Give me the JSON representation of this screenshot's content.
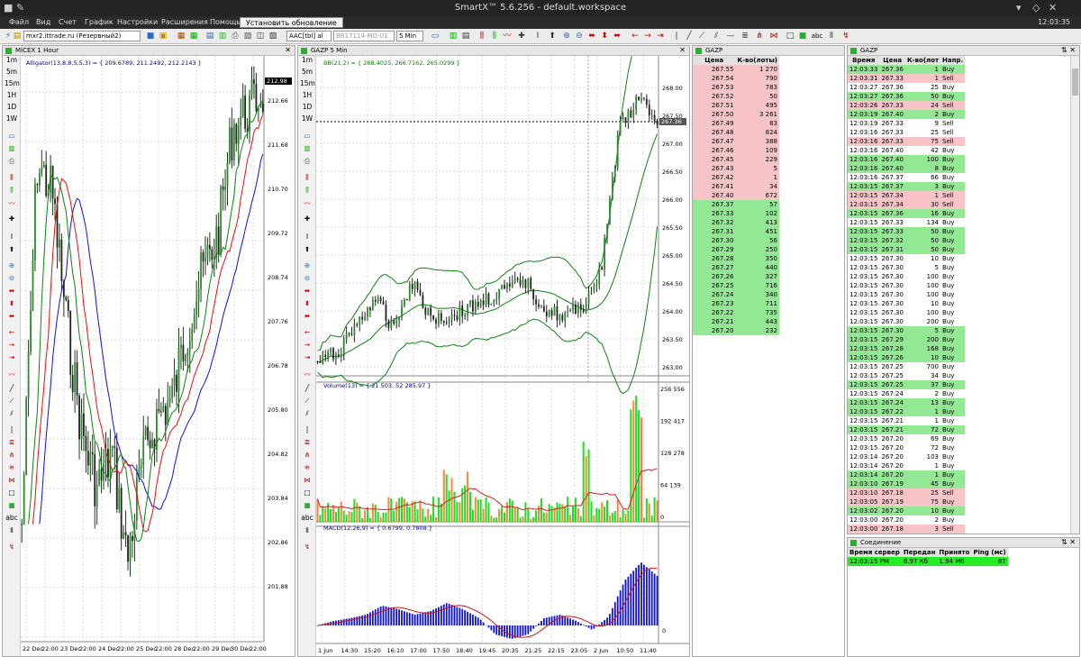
{
  "app": {
    "title": "SmartX™ 5.6.256 - default.workspace",
    "clock": "12:03:35"
  },
  "menu": [
    "Файл",
    "Вид",
    "Счет",
    "График",
    "Настройки",
    "Расширения",
    "Помощь"
  ],
  "update_button": "Установить обновление",
  "toolbar": {
    "account": "mxr2.ittrade.ru (Резервный2)",
    "symbol": "AAC[tbl] al",
    "instrument": "BR17114-MO-01",
    "interval": "5 Min"
  },
  "timeframes": [
    "1m",
    "5m",
    "15m",
    "1H",
    "1D",
    "1W"
  ],
  "chart1": {
    "title": "MICEX 1 Hour",
    "indicator": "Alligator(13,8,8,5,5,3) = { 209.6789, 211.2492, 212.2143 }",
    "price_tag": "212.98",
    "y_ticks": [
      "212.66",
      "211.68",
      "210.70",
      "209.72",
      "208.74",
      "207.76",
      "206.78",
      "205.80",
      "204.82",
      "203.84",
      "202.86",
      "201.88"
    ],
    "x_ticks": [
      "22 Dec",
      "22:00",
      "23 Dec",
      "22:00",
      "24 Dec",
      "22:00",
      "25 Dec",
      "22:00",
      "28 Dec",
      "22:00",
      "29 Dec",
      "30 Dec",
      "22:00"
    ]
  },
  "chart2": {
    "title": "GAZP 5 Min",
    "indicator": "BB(21,2) = { 268.4025, 266.7162, 265.0299 }",
    "price_tag": "267.36",
    "y_ticks": [
      "268.00",
      "267.50",
      "267.00",
      "266.50",
      "266.00",
      "265.50",
      "265.00",
      "264.50",
      "264.00",
      "263.50",
      "263.00"
    ],
    "vol_label": "Volume(13) = { 21 503, 52 285.97 }",
    "vol_ticks": [
      "256 556",
      "192 417",
      "128 278",
      "64 139",
      "0"
    ],
    "macd_label": "MACD(12,26,9) = { 0.6799, 0.7808 }",
    "macd_tick": "0",
    "x_ticks": [
      "1 Jun",
      "14:30",
      "15:20",
      "16:10",
      "17:00",
      "17:50",
      "18:40",
      "19:45",
      "20:35",
      "21:25",
      "22:15",
      "23:05",
      "2 Jun",
      "10:50",
      "11:40"
    ]
  },
  "book": {
    "title": "GAZP",
    "headers": [
      "Цена",
      "К-во(лоты)"
    ],
    "rows": [
      [
        "267.55",
        "1 270",
        "s"
      ],
      [
        "267.54",
        "790",
        "s"
      ],
      [
        "267.53",
        "783",
        "s"
      ],
      [
        "267.52",
        "50",
        "s"
      ],
      [
        "267.51",
        "495",
        "s"
      ],
      [
        "267.50",
        "3 261",
        "s"
      ],
      [
        "267.49",
        "83",
        "s"
      ],
      [
        "267.48",
        "824",
        "s"
      ],
      [
        "267.47",
        "388",
        "s"
      ],
      [
        "267.46",
        "109",
        "s"
      ],
      [
        "267.45",
        "229",
        "s"
      ],
      [
        "267.43",
        "5",
        "s"
      ],
      [
        "267.42",
        "1",
        "s"
      ],
      [
        "267.41",
        "34",
        "s"
      ],
      [
        "267.40",
        "672",
        "s"
      ],
      [
        "267.37",
        "57",
        "b"
      ],
      [
        "267.33",
        "102",
        "b"
      ],
      [
        "267.32",
        "413",
        "b"
      ],
      [
        "267.31",
        "451",
        "b"
      ],
      [
        "267.30",
        "56",
        "b"
      ],
      [
        "267.29",
        "250",
        "b"
      ],
      [
        "267.28",
        "350",
        "b"
      ],
      [
        "267.27",
        "440",
        "b"
      ],
      [
        "267.26",
        "327",
        "b"
      ],
      [
        "267.25",
        "716",
        "b"
      ],
      [
        "267.24",
        "340",
        "b"
      ],
      [
        "267.23",
        "711",
        "b"
      ],
      [
        "267.22",
        "735",
        "b"
      ],
      [
        "267.21",
        "443",
        "b"
      ],
      [
        "267.20",
        "232",
        "b"
      ]
    ]
  },
  "trades": {
    "title": "GAZP",
    "headers": [
      "Время",
      "Цена",
      "К-во(лот",
      "Напр."
    ],
    "rows": [
      [
        "12:03:33",
        "267.36",
        "1",
        "Buy"
      ],
      [
        "12:03:31",
        "267.33",
        "1",
        "Sell"
      ],
      [
        "12:03:27",
        "267.36",
        "25",
        "Buy"
      ],
      [
        "12:03:27",
        "267.36",
        "50",
        "Buy"
      ],
      [
        "12:03:26",
        "267.33",
        "24",
        "Sell"
      ],
      [
        "12:03:19",
        "267.40",
        "2",
        "Buy"
      ],
      [
        "12:03:19",
        "267.33",
        "9",
        "Sell"
      ],
      [
        "12:03:16",
        "267.33",
        "25",
        "Sell"
      ],
      [
        "12:03:16",
        "267.33",
        "75",
        "Sell"
      ],
      [
        "12:03:16",
        "267.40",
        "42",
        "Buy"
      ],
      [
        "12:03:16",
        "267.40",
        "100",
        "Buy"
      ],
      [
        "12:03:16",
        "267.40",
        "8",
        "Buy"
      ],
      [
        "12:03:16",
        "267.37",
        "66",
        "Buy"
      ],
      [
        "12:03:15",
        "267.37",
        "3",
        "Buy"
      ],
      [
        "12:03:15",
        "267.34",
        "1",
        "Sell"
      ],
      [
        "12:03:15",
        "267.34",
        "30",
        "Sell"
      ],
      [
        "12:03:15",
        "267.36",
        "16",
        "Buy"
      ],
      [
        "12:03:15",
        "267.33",
        "134",
        "Buy"
      ],
      [
        "12:03:15",
        "267.33",
        "50",
        "Buy"
      ],
      [
        "12:03:15",
        "267.32",
        "50",
        "Buy"
      ],
      [
        "12:03:15",
        "267.31",
        "50",
        "Buy"
      ],
      [
        "12:03:15",
        "267.30",
        "10",
        "Buy"
      ],
      [
        "12:03:15",
        "267.30",
        "5",
        "Buy"
      ],
      [
        "12:03:15",
        "267.30",
        "100",
        "Buy"
      ],
      [
        "12:03:15",
        "267.30",
        "100",
        "Buy"
      ],
      [
        "12:03:15",
        "267.30",
        "100",
        "Buy"
      ],
      [
        "12:03:15",
        "267.30",
        "10",
        "Buy"
      ],
      [
        "12:03:15",
        "267.30",
        "100",
        "Buy"
      ],
      [
        "12:03:15",
        "267.30",
        "200",
        "Buy"
      ],
      [
        "12:03:15",
        "267.30",
        "5",
        "Buy"
      ],
      [
        "12:03:15",
        "267.29",
        "200",
        "Buy"
      ],
      [
        "12:03:15",
        "267.28",
        "168",
        "Buy"
      ],
      [
        "12:03:15",
        "267.26",
        "10",
        "Buy"
      ],
      [
        "12:03:15",
        "267.25",
        "700",
        "Buy"
      ],
      [
        "12:03:15",
        "267.25",
        "34",
        "Buy"
      ],
      [
        "12:03:15",
        "267.25",
        "37",
        "Buy"
      ],
      [
        "12:03:15",
        "267.24",
        "2",
        "Buy"
      ],
      [
        "12:03:15",
        "267.24",
        "13",
        "Buy"
      ],
      [
        "12:03:15",
        "267.22",
        "1",
        "Buy"
      ],
      [
        "12:03:15",
        "267.21",
        "1",
        "Buy"
      ],
      [
        "12:03:15",
        "267.21",
        "72",
        "Buy"
      ],
      [
        "12:03:15",
        "267.20",
        "69",
        "Buy"
      ],
      [
        "12:03:15",
        "267.20",
        "72",
        "Buy"
      ],
      [
        "12:03:14",
        "267.20",
        "103",
        "Buy"
      ],
      [
        "12:03:14",
        "267.20",
        "1",
        "Buy"
      ],
      [
        "12:03:14",
        "267.20",
        "1",
        "Buy"
      ],
      [
        "12:03:10",
        "267.19",
        "45",
        "Buy"
      ],
      [
        "12:03:10",
        "267.18",
        "25",
        "Sell"
      ],
      [
        "12:03:05",
        "267.19",
        "75",
        "Buy"
      ],
      [
        "12:03:02",
        "267.20",
        "10",
        "Buy"
      ],
      [
        "12:03:00",
        "267.20",
        "2",
        "Buy"
      ],
      [
        "12:03:00",
        "267.18",
        "3",
        "Sell"
      ]
    ],
    "green_rows": [
      0,
      3,
      5,
      10,
      11,
      13,
      16,
      18,
      19,
      20,
      29,
      30,
      31,
      32,
      35,
      37,
      38,
      40,
      45,
      46,
      49
    ],
    "red_rows": [
      1,
      4,
      8,
      14,
      15,
      47,
      48,
      51
    ]
  },
  "conn": {
    "title": "Соединение",
    "headers": [
      "Время сервер",
      "Передан",
      "Принято",
      "Ping (мс)"
    ],
    "row": [
      "12:03:15 PM",
      "8.97 Кб",
      "1.94 Мб",
      "87"
    ]
  },
  "colors": {
    "buy": "#93e893",
    "sell": "#f8c4c8",
    "alligator_jaw": "#1010d0",
    "alligator_teeth": "#e01010",
    "alligator_lips": "#108010",
    "bb": "#108010",
    "volume": "#20dd20",
    "macd": "#1010d0",
    "macd_signal": "#d01010"
  }
}
